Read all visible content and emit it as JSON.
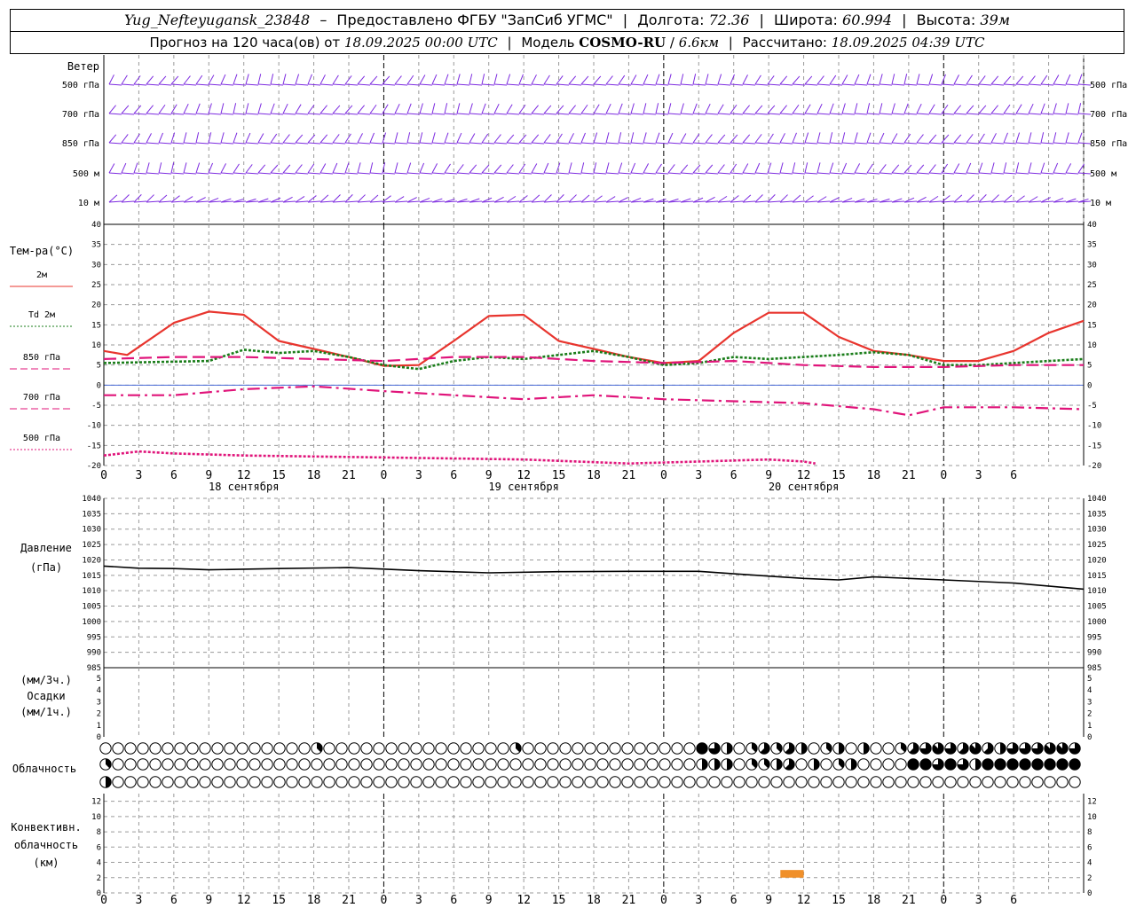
{
  "header": {
    "station": "Yug_Nefteyugansk_23848",
    "provider": "Предоставлено ФГБУ \"ЗапСиб УГМС\"",
    "lon_label": "Долгота:",
    "lon": "72.36",
    "lat_label": "Широта:",
    "lat": "60.994",
    "alt_label": "Высота:",
    "alt": "39м",
    "forecast_label": "Прогноз на 120 часа(ов) от",
    "forecast_from": "18.09.2025 00:00 UTC",
    "model_label": "Модель",
    "model": "COSMO-RU",
    "resolution": "6.6км",
    "computed_label": "Рассчитано:",
    "computed": "18.09.2025 04:39 UTC"
  },
  "chart_data": {
    "type": "line",
    "x_ticks": [
      "0",
      "3",
      "6",
      "9",
      "12",
      "15",
      "18",
      "21",
      "0",
      "3",
      "6",
      "9",
      "12",
      "15",
      "18",
      "21",
      "0",
      "3",
      "6",
      "9",
      "12",
      "15",
      "18",
      "21",
      "0",
      "3",
      "6"
    ],
    "day_labels": [
      "18 сентября",
      "19 сентября",
      "20 сентября"
    ],
    "wind": {
      "title": "Ветер",
      "levels": [
        "500 гПа",
        "700 гПа",
        "850 гПа",
        "500 м",
        "10 м"
      ]
    },
    "temperature": {
      "title": "Тем-ра(°C)",
      "ylim": [
        -20,
        40
      ],
      "y_ticks": [
        40,
        35,
        30,
        25,
        20,
        15,
        10,
        5,
        0,
        -5,
        -10,
        -15,
        -20
      ],
      "series": [
        {
          "name": "2м",
          "color": "#e8352e",
          "style": "solid",
          "points": [
            [
              0,
              8.5
            ],
            [
              2,
              7.5
            ],
            [
              6,
              15.5
            ],
            [
              9,
              18.3
            ],
            [
              12,
              17.5
            ],
            [
              15,
              11
            ],
            [
              18,
              9
            ],
            [
              21,
              7
            ],
            [
              24,
              4.8
            ],
            [
              27,
              5
            ],
            [
              30,
              11
            ],
            [
              33,
              17.2
            ],
            [
              36,
              17.5
            ],
            [
              39,
              11
            ],
            [
              42,
              9
            ],
            [
              45,
              7
            ],
            [
              48,
              5.5
            ],
            [
              51,
              6
            ],
            [
              54,
              13
            ],
            [
              57,
              18
            ],
            [
              60,
              18
            ],
            [
              63,
              12
            ],
            [
              66,
              8.5
            ],
            [
              69,
              7.5
            ],
            [
              72,
              6
            ],
            [
              75,
              6
            ],
            [
              78,
              8.5
            ],
            [
              81,
              13
            ],
            [
              84,
              16
            ]
          ]
        },
        {
          "name": "Td 2м",
          "color": "#1a7d1a",
          "style": "dotted",
          "points": [
            [
              0,
              5.5
            ],
            [
              9,
              6
            ],
            [
              12,
              8.8
            ],
            [
              15,
              8
            ],
            [
              18,
              8.5
            ],
            [
              21,
              7
            ],
            [
              24,
              5
            ],
            [
              27,
              4
            ],
            [
              30,
              6
            ],
            [
              33,
              7
            ],
            [
              36,
              6.5
            ],
            [
              39,
              7.5
            ],
            [
              42,
              8.5
            ],
            [
              45,
              7
            ],
            [
              48,
              5
            ],
            [
              51,
              5.5
            ],
            [
              54,
              7
            ],
            [
              57,
              6.5
            ],
            [
              60,
              7
            ],
            [
              63,
              7.5
            ],
            [
              66,
              8.2
            ],
            [
              69,
              7.5
            ],
            [
              72,
              5
            ],
            [
              75,
              5
            ],
            [
              78,
              5.5
            ],
            [
              81,
              6
            ],
            [
              84,
              6.5
            ]
          ]
        },
        {
          "name": "850 гПа",
          "color": "#e0147a",
          "style": "longdash",
          "points": [
            [
              0,
              6.5
            ],
            [
              6,
              7
            ],
            [
              12,
              7
            ],
            [
              18,
              6.5
            ],
            [
              24,
              6
            ],
            [
              30,
              7
            ],
            [
              36,
              7
            ],
            [
              42,
              6
            ],
            [
              48,
              5.5
            ],
            [
              54,
              6
            ],
            [
              60,
              5
            ],
            [
              66,
              4.5
            ],
            [
              72,
              4.5
            ],
            [
              78,
              5
            ],
            [
              84,
              5
            ]
          ]
        },
        {
          "name": "700 гПа",
          "color": "#e0147a",
          "style": "dashdot",
          "points": [
            [
              0,
              -2.5
            ],
            [
              6,
              -2.5
            ],
            [
              12,
              -1
            ],
            [
              18,
              -0.3
            ],
            [
              24,
              -1.5
            ],
            [
              30,
              -2.5
            ],
            [
              36,
              -3.5
            ],
            [
              42,
              -2.5
            ],
            [
              48,
              -3.5
            ],
            [
              54,
              -4
            ],
            [
              60,
              -4.5
            ],
            [
              66,
              -6
            ],
            [
              69,
              -7.5
            ],
            [
              72,
              -5.5
            ],
            [
              78,
              -5.5
            ],
            [
              84,
              -6
            ]
          ]
        },
        {
          "name": "500 гПа",
          "color": "#e0147a",
          "style": "dotted",
          "points": [
            [
              0,
              -17.5
            ],
            [
              3,
              -16.5
            ],
            [
              6,
              -17
            ],
            [
              12,
              -17.5
            ],
            [
              24,
              -18
            ],
            [
              36,
              -18.5
            ],
            [
              45,
              -19.5
            ],
            [
              51,
              -19
            ],
            [
              57,
              -18.5
            ],
            [
              60,
              -19
            ],
            [
              61,
              -19.5
            ]
          ]
        }
      ]
    },
    "pressure": {
      "title": "Давление",
      "unit": "(гПа)",
      "ylim": [
        985,
        1040
      ],
      "y_ticks": [
        1040,
        1035,
        1030,
        1025,
        1020,
        1015,
        1010,
        1005,
        1000,
        995,
        990,
        985
      ],
      "series": [
        {
          "name": "",
          "color": "#000000",
          "points": [
            [
              0,
              1018
            ],
            [
              3,
              1017.3
            ],
            [
              6,
              1017.2
            ],
            [
              9,
              1016.8
            ],
            [
              15,
              1017.2
            ],
            [
              21,
              1017.5
            ],
            [
              27,
              1016.5
            ],
            [
              33,
              1015.8
            ],
            [
              39,
              1016.2
            ],
            [
              45,
              1016.3
            ],
            [
              51,
              1016.3
            ],
            [
              54,
              1015.5
            ],
            [
              60,
              1014
            ],
            [
              63,
              1013.5
            ],
            [
              66,
              1014.5
            ],
            [
              69,
              1014
            ],
            [
              72,
              1013.5
            ],
            [
              78,
              1012.5
            ],
            [
              84,
              1010.5
            ]
          ]
        }
      ]
    },
    "precipitation": {
      "unit_3h": "(мм/3ч.)",
      "title": "Осадки",
      "unit_1h": "(мм/1ч.)",
      "ylim": [
        0,
        5
      ],
      "y_ticks": [
        5,
        4,
        3,
        2,
        1,
        0
      ],
      "values": []
    },
    "cloudiness": {
      "title": "Облачность",
      "steps_per_row": 79,
      "rows": [
        {
          "level": "upper",
          "spans": [
            [
              0,
              16,
              0
            ],
            [
              17,
              17,
              3
            ],
            [
              18,
              32,
              0
            ],
            [
              33,
              33,
              3
            ],
            [
              34,
              47,
              0
            ],
            [
              48,
              48,
              8
            ],
            [
              49,
              49,
              6
            ],
            [
              50,
              50,
              4
            ],
            [
              51,
              51,
              0
            ],
            [
              52,
              52,
              3
            ],
            [
              53,
              53,
              5
            ],
            [
              54,
              54,
              3
            ],
            [
              55,
              55,
              5
            ],
            [
              56,
              56,
              4
            ],
            [
              57,
              57,
              0
            ],
            [
              58,
              58,
              3
            ],
            [
              59,
              59,
              4
            ],
            [
              60,
              60,
              0
            ],
            [
              61,
              61,
              4
            ],
            [
              62,
              62,
              0
            ],
            [
              63,
              63,
              0
            ],
            [
              64,
              64,
              3
            ],
            [
              65,
              65,
              5
            ],
            [
              66,
              66,
              6
            ],
            [
              67,
              67,
              7
            ],
            [
              68,
              68,
              6
            ],
            [
              69,
              69,
              5
            ],
            [
              70,
              70,
              7
            ],
            [
              71,
              71,
              5
            ],
            [
              72,
              72,
              4
            ],
            [
              73,
              73,
              6
            ],
            [
              74,
              74,
              6
            ],
            [
              75,
              75,
              6
            ],
            [
              76,
              76,
              7
            ],
            [
              77,
              77,
              7
            ],
            [
              78,
              78,
              6
            ]
          ]
        },
        {
          "level": "middle",
          "spans": [
            [
              0,
              0,
              3
            ],
            [
              1,
              47,
              0
            ],
            [
              48,
              48,
              4
            ],
            [
              49,
              49,
              4
            ],
            [
              50,
              50,
              4
            ],
            [
              51,
              51,
              0
            ],
            [
              52,
              52,
              3
            ],
            [
              53,
              53,
              3
            ],
            [
              54,
              54,
              4
            ],
            [
              55,
              55,
              5
            ],
            [
              56,
              56,
              0
            ],
            [
              57,
              57,
              4
            ],
            [
              58,
              58,
              0
            ],
            [
              59,
              59,
              3
            ],
            [
              60,
              60,
              4
            ],
            [
              61,
              64,
              0
            ],
            [
              65,
              65,
              8
            ],
            [
              66,
              66,
              8
            ],
            [
              67,
              67,
              6
            ],
            [
              68,
              68,
              8
            ],
            [
              69,
              69,
              6
            ],
            [
              70,
              70,
              4
            ],
            [
              71,
              78,
              8
            ]
          ]
        },
        {
          "level": "lower",
          "spans": [
            [
              0,
              0,
              4
            ],
            [
              1,
              78,
              0
            ]
          ]
        }
      ]
    },
    "convective": {
      "title_lines": [
        "Конвективн.",
        "облачность",
        "(км)"
      ],
      "ylim": [
        0,
        13
      ],
      "y_ticks": [
        12,
        10,
        8,
        6,
        4,
        2,
        0
      ],
      "bars": [
        {
          "x_from": 58,
          "x_to": 60,
          "bottom": 2,
          "top": 3,
          "color": "#f0902a"
        }
      ]
    }
  }
}
